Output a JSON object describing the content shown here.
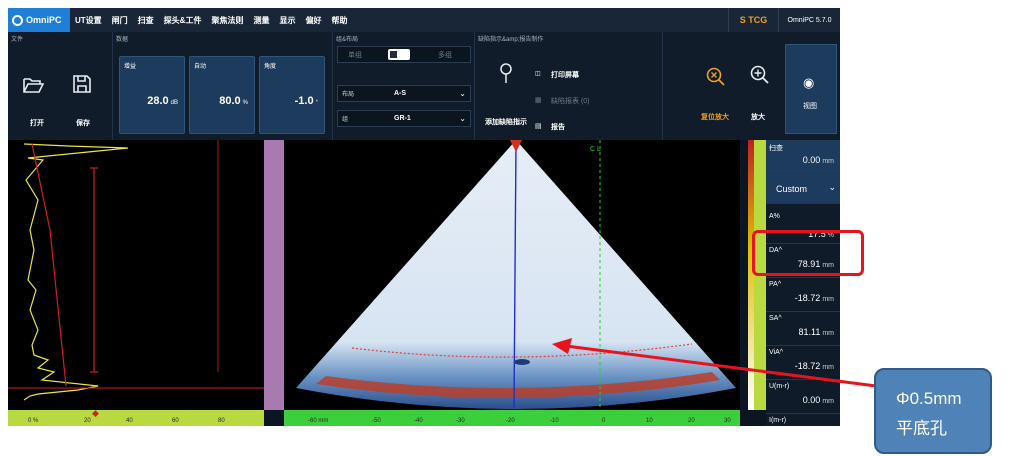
{
  "app": {
    "logo": "OmniPC",
    "version": "OmniPC 5.7.0",
    "tcg": "S TCG"
  },
  "menu": [
    "UT设置",
    "闸门",
    "扫查",
    "探头&工件",
    "聚焦法则",
    "测量",
    "显示",
    "偏好",
    "帮助"
  ],
  "ribbon": {
    "file": {
      "title": "文件",
      "open": "打开",
      "save": "保存"
    },
    "data": {
      "title": "数据",
      "gain": {
        "label": "增益",
        "value": "28.0",
        "unit": "dB"
      },
      "auto": {
        "label": "自动",
        "value": "80.0",
        "unit": "%"
      },
      "angle": {
        "label": "角度",
        "value": "-1.0",
        "unit": "°"
      }
    },
    "group_layout": {
      "title": "组&布局",
      "single": "单组",
      "multi": "多组",
      "layout_label": "布局",
      "layout_value": "A-S",
      "group_label": "组",
      "group_value": "GR-1"
    },
    "report": {
      "title": "缺陷指示&amp;报告制作",
      "add_indication": "添加缺陷指示",
      "print_screen": "打印屏幕",
      "defect_table": "缺陷报表 (0)",
      "report": "报告"
    },
    "zoom": {
      "reset": "复位放大",
      "zoom": "放大",
      "view": "视图"
    }
  },
  "readings": {
    "scan": {
      "label": "扫查",
      "value": "0.00",
      "unit": "mm"
    },
    "preset": "Custom",
    "a_pct": {
      "label": "A%",
      "value": "17.5",
      "unit": "%"
    },
    "da": {
      "label": "DA^",
      "value": "78.91",
      "unit": "mm"
    },
    "pa": {
      "label": "PA^",
      "value": "-18.72",
      "unit": "mm"
    },
    "sa": {
      "label": "SA^",
      "value": "81.11",
      "unit": "mm"
    },
    "via": {
      "label": "ViA^",
      "value": "-18.72",
      "unit": "mm"
    },
    "u": {
      "label": "U(m-r)",
      "value": "0.00",
      "unit": "mm"
    },
    "i": {
      "label": "I(m-r)"
    }
  },
  "ascan_axis": [
    "0 %",
    "20",
    "40",
    "60",
    "80"
  ],
  "sscan_axis": [
    "-60 mm",
    "-50",
    "-40",
    "-30",
    "-20",
    "-10",
    "0",
    "10",
    "20",
    "30"
  ],
  "sscan_marker": "C L",
  "annotation": {
    "line1": "Φ0.5mm",
    "line2": "平底孔"
  }
}
